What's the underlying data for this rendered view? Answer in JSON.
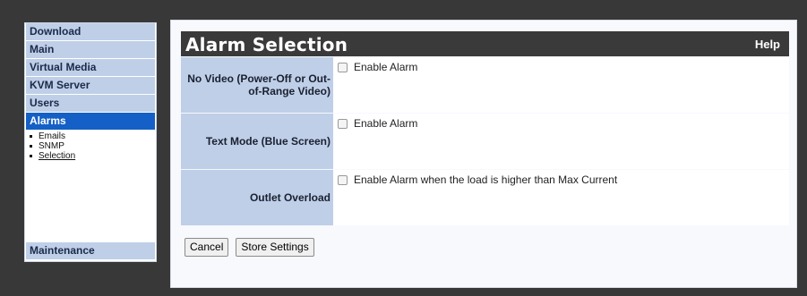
{
  "sidebar": {
    "items": [
      {
        "label": "Download"
      },
      {
        "label": "Main"
      },
      {
        "label": "Virtual Media"
      },
      {
        "label": "KVM Server"
      },
      {
        "label": "Users"
      },
      {
        "label": "Alarms"
      }
    ],
    "subitems": [
      {
        "label": "Emails"
      },
      {
        "label": "SNMP"
      },
      {
        "label": "Selection"
      }
    ],
    "bottom": {
      "label": "Maintenance"
    }
  },
  "header": {
    "title": "Alarm Selection",
    "help": "Help"
  },
  "rows": [
    {
      "label_lines": [
        "No Video (Power-Off or Out-",
        "of-Range Video)"
      ],
      "checkbox_label": "Enable Alarm",
      "checked": false
    },
    {
      "label_lines": [
        "Text Mode (Blue Screen)"
      ],
      "checkbox_label": "Enable Alarm",
      "checked": false
    },
    {
      "label_lines": [
        "Outlet Overload"
      ],
      "checkbox_label": "Enable Alarm when the load is higher than Max Current",
      "checked": false
    }
  ],
  "buttons": {
    "cancel": "Cancel",
    "store": "Store Settings"
  },
  "colors": {
    "background": "#383838",
    "nav_bg": "#bfcfe8",
    "nav_active": "#1560c6",
    "header_bg": "#3a3a3a"
  }
}
